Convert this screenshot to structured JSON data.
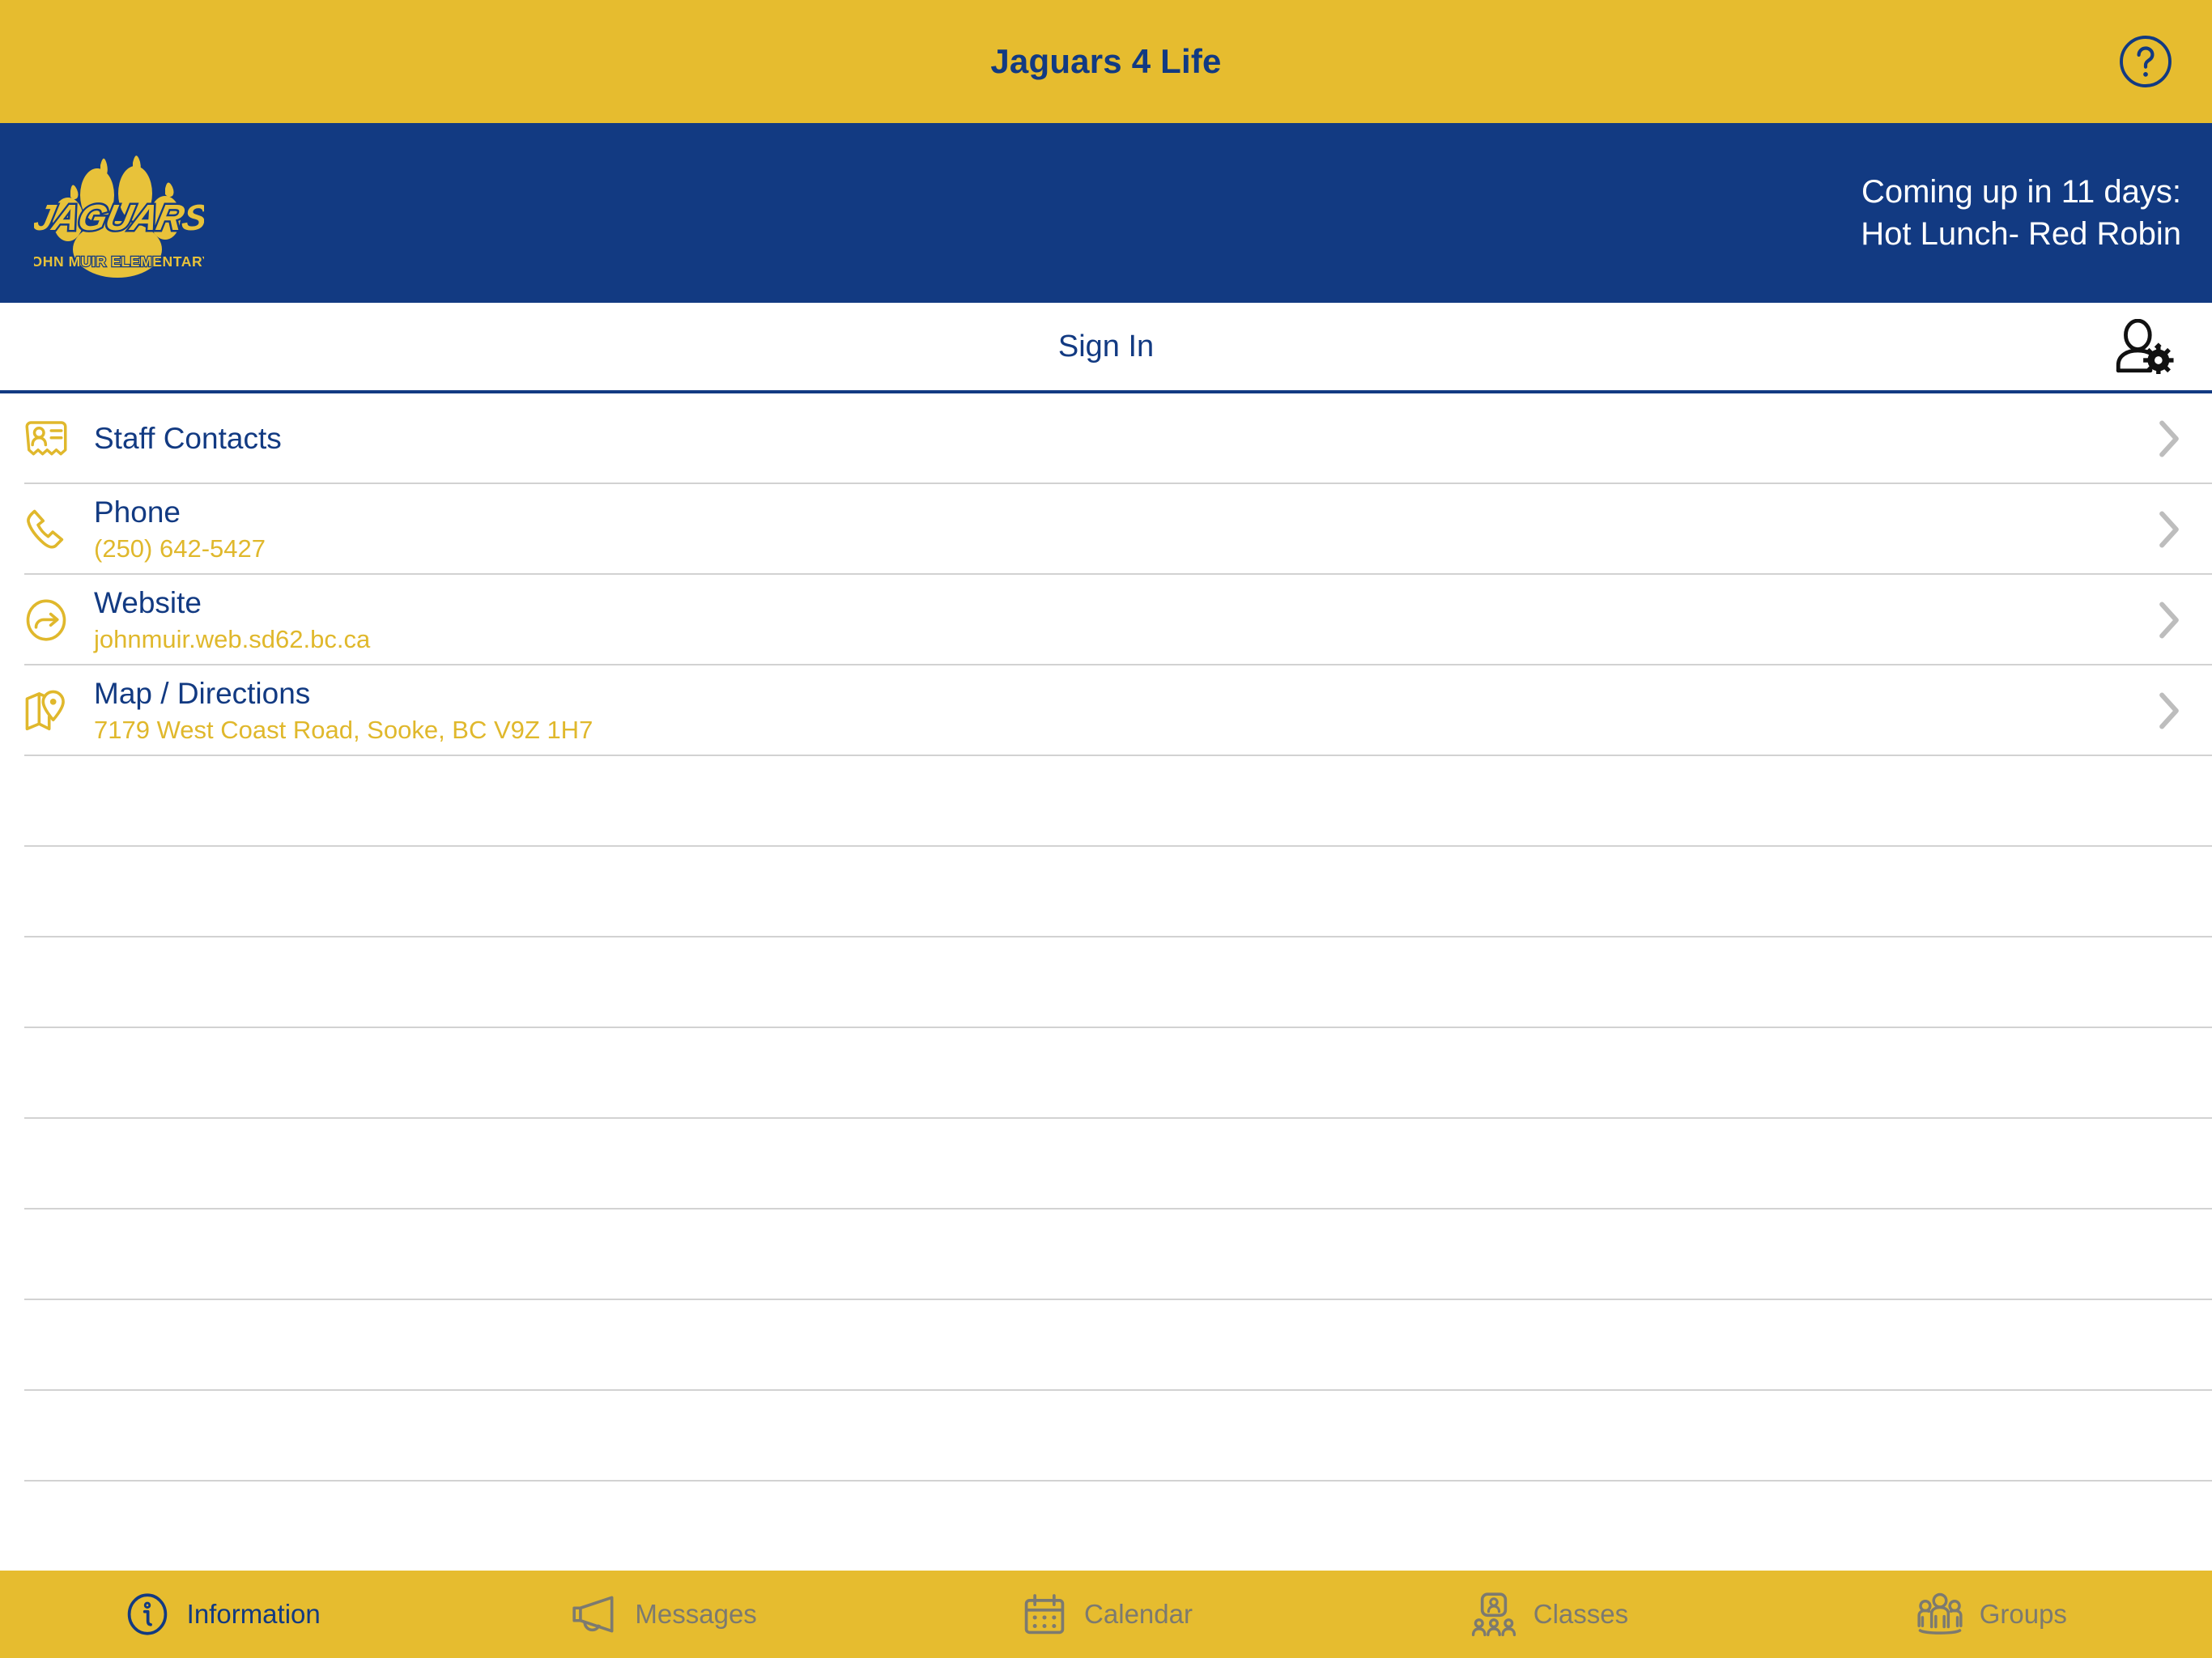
{
  "titlebar": {
    "title": "Jaguars 4 Life",
    "help_icon": "question-circle-icon"
  },
  "banner": {
    "logo_primary_text": "JAGUARS",
    "logo_secondary_text": "JOHN MUIR ELEMENTARY",
    "coming_up_line1": "Coming up in 11 days:",
    "coming_up_line2": "Hot Lunch- Red Robin"
  },
  "signin_bar": {
    "label": "Sign In",
    "account_icon": "user-settings-icon"
  },
  "list": {
    "rows": [
      {
        "icon": "contact-card-icon",
        "title": "Staff Contacts",
        "subtitle": ""
      },
      {
        "icon": "phone-icon",
        "title": "Phone",
        "subtitle": "(250) 642-5427"
      },
      {
        "icon": "external-link-icon",
        "title": "Website",
        "subtitle": "johnmuir.web.sd62.bc.ca"
      },
      {
        "icon": "map-pin-icon",
        "title": "Map / Directions",
        "subtitle": "7179 West Coast Road, Sooke, BC V9Z 1H7"
      }
    ],
    "empty_row_count": 9
  },
  "tabbar": {
    "tabs": [
      {
        "label": "Information",
        "icon": "info-circle-icon",
        "active": true
      },
      {
        "label": "Messages",
        "icon": "megaphone-icon",
        "active": false
      },
      {
        "label": "Calendar",
        "icon": "calendar-icon",
        "active": false
      },
      {
        "label": "Classes",
        "icon": "classes-icon",
        "active": false
      },
      {
        "label": "Groups",
        "icon": "groups-icon",
        "active": false
      }
    ]
  },
  "colors": {
    "brand_yellow": "#e6bc2f",
    "brand_navy": "#123a82",
    "subtitle_yellow": "#e0b82c",
    "tab_inactive": "#7c7a70",
    "separator": "#d2d2d2"
  }
}
